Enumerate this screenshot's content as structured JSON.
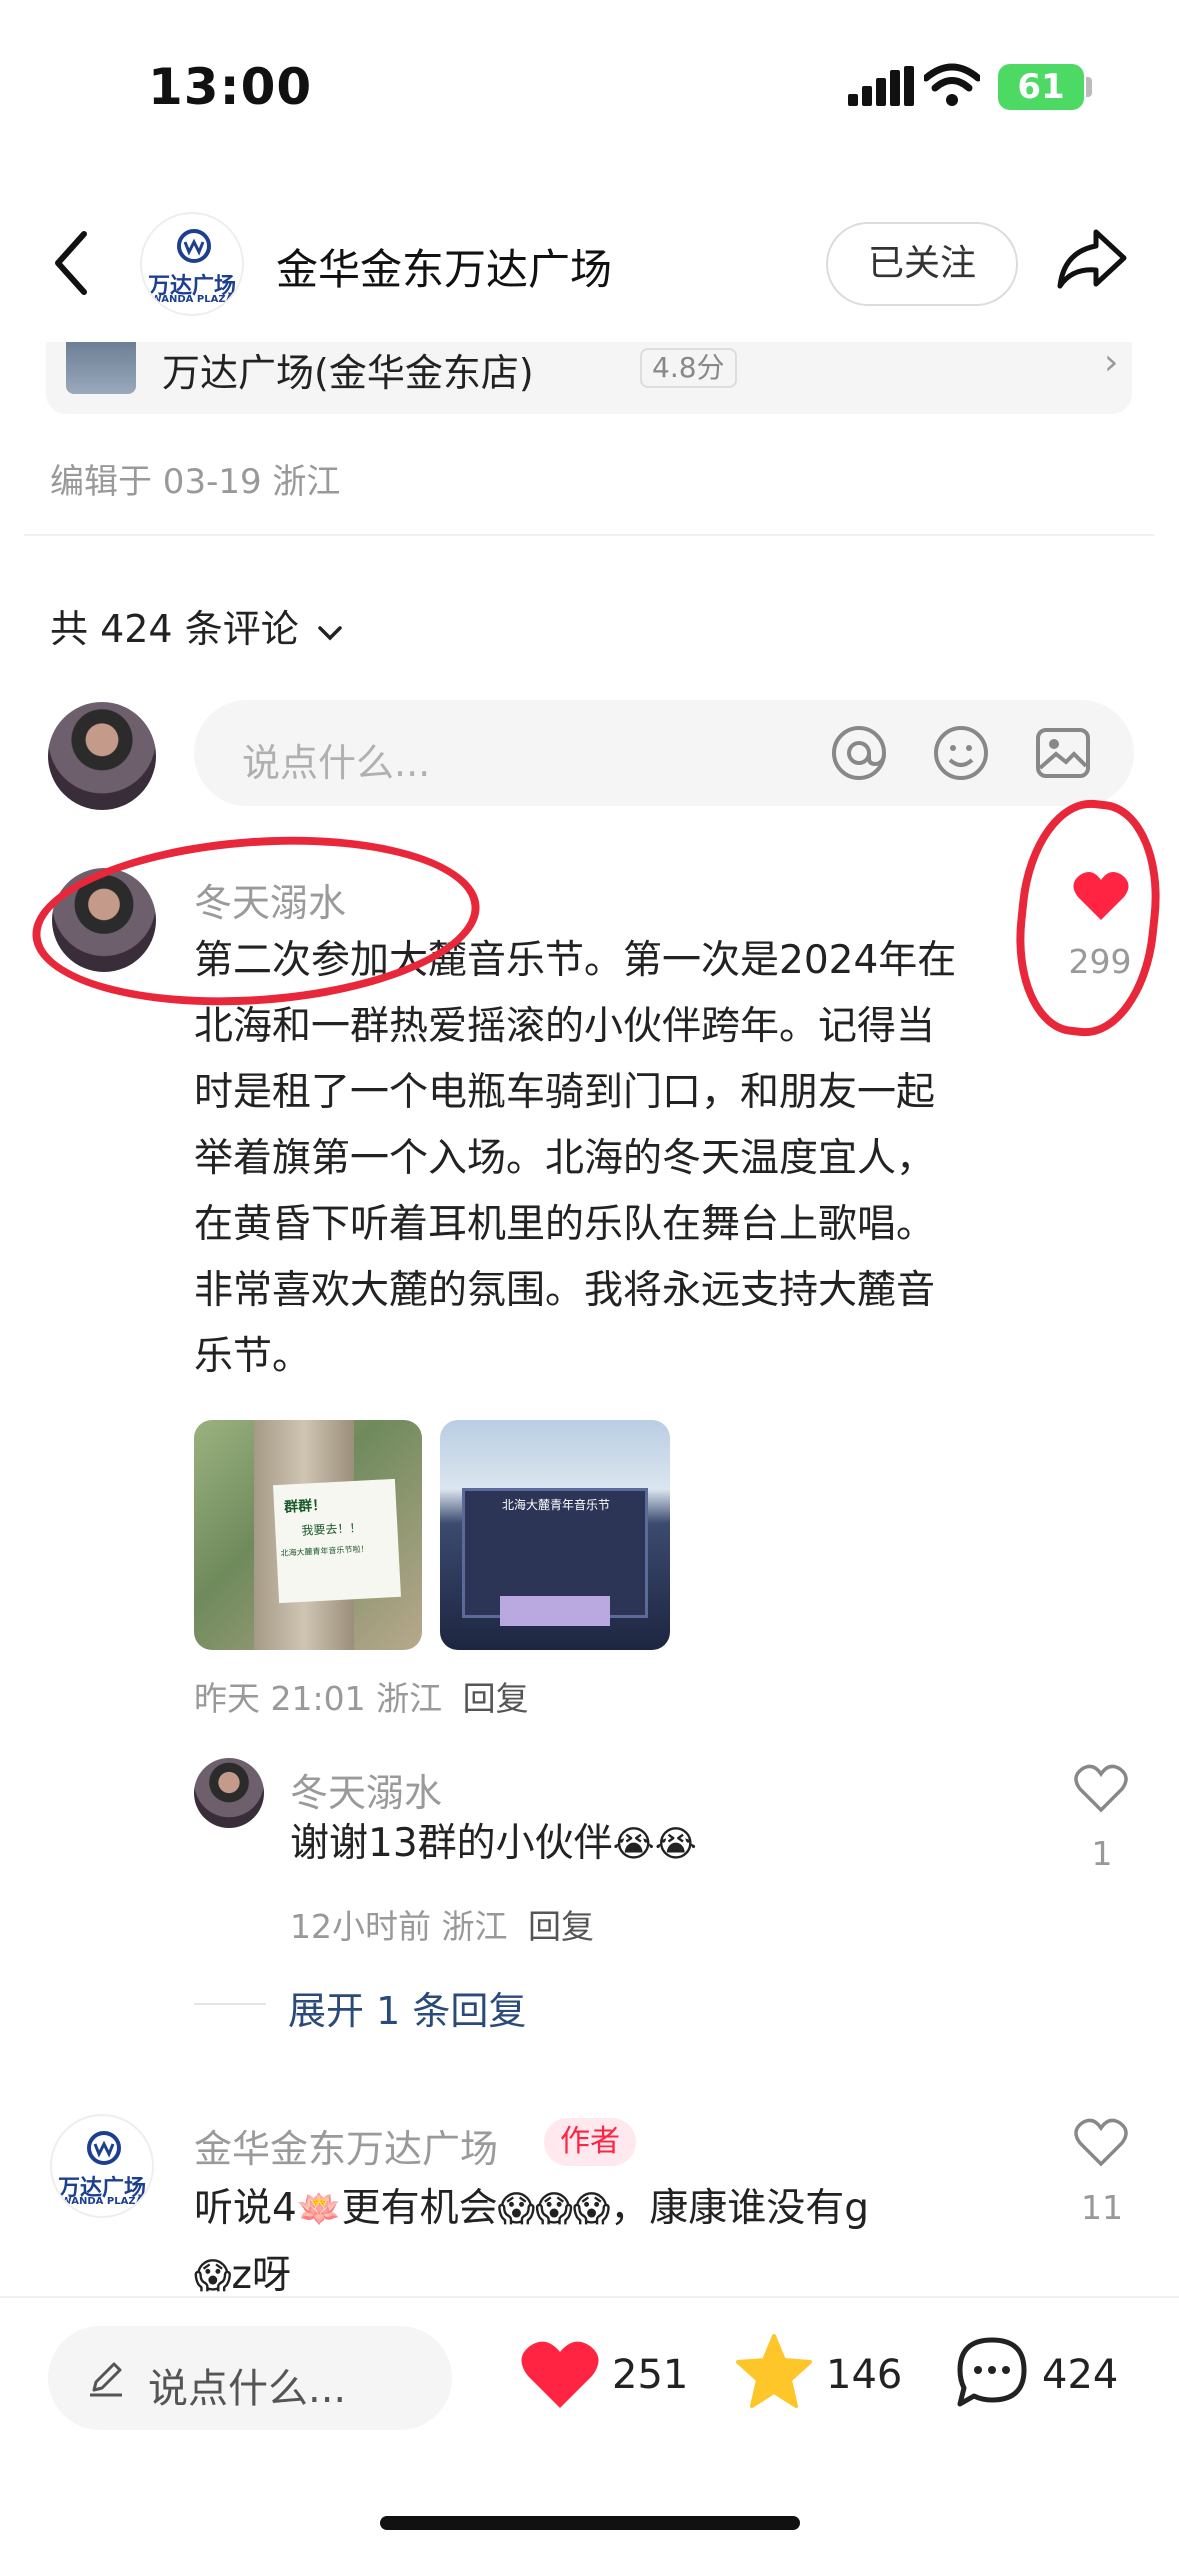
{
  "status_bar": {
    "time": "13:00",
    "battery": "61"
  },
  "header": {
    "title": "金华金东万达广场",
    "follow_label": "已关注",
    "logo_cn": "万达广场",
    "logo_en": "WANDA PLAZA"
  },
  "location_card": {
    "name": "万达广场(金华金东店)",
    "score": "4.8分"
  },
  "edit_info": "编辑于 03-19 浙江",
  "comments_header": {
    "label": "共 424 条评论"
  },
  "comment_input": {
    "placeholder": "说点什么..."
  },
  "comments": [
    {
      "user": "冬天溺水",
      "text_lines": [
        "第二次参加大麓音乐节。第一次是2024年在",
        "北海和一群热爱摇滚的小伙伴跨年。记得当",
        "时是租了一个电瓶车骑到门口，和朋友一起",
        "举着旗第一个入场。北海的冬天温度宜人，",
        "在黄昏下听着耳机里的乐队在舞台上歌唱。",
        "非常喜欢大麓的氛围。我将永远支持大麓音",
        "乐节。"
      ],
      "likes": "299",
      "liked": true,
      "time_location": "昨天 21:01 浙江",
      "reply_label": "回复",
      "photos": [
        {
          "sign_lines": [
            "群群！",
            "我要去！！",
            "北海大麓青年音乐节啦！"
          ]
        },
        {
          "banner": "北海大麓青年音乐节"
        }
      ],
      "replies": [
        {
          "user": "冬天溺水",
          "text": "谢谢13群的小伙伴",
          "emoji": "😭😭",
          "likes": "1",
          "time_location": "12小时前 浙江",
          "reply_label": "回复"
        }
      ],
      "expand_label": "展开 1 条回复"
    },
    {
      "user": "金华金东万达广场",
      "badge": "作者",
      "text_line1_a": "听说4",
      "text_line1_b": "更有机会",
      "text_line1_c": "，康康谁没有g",
      "text_line2": "z呀",
      "emoji_lotus": "🪷",
      "emoji_faces": "😱😱😱",
      "emoji_face_single": "😱",
      "likes": "11"
    }
  ],
  "bottom_bar": {
    "input_placeholder": "说点什么...",
    "likes": "251",
    "stars": "146",
    "comments": "424"
  },
  "colors": {
    "accent_red": "#ff2442",
    "annotation_red": "#e8283a",
    "link_blue": "#2a4a7a"
  }
}
